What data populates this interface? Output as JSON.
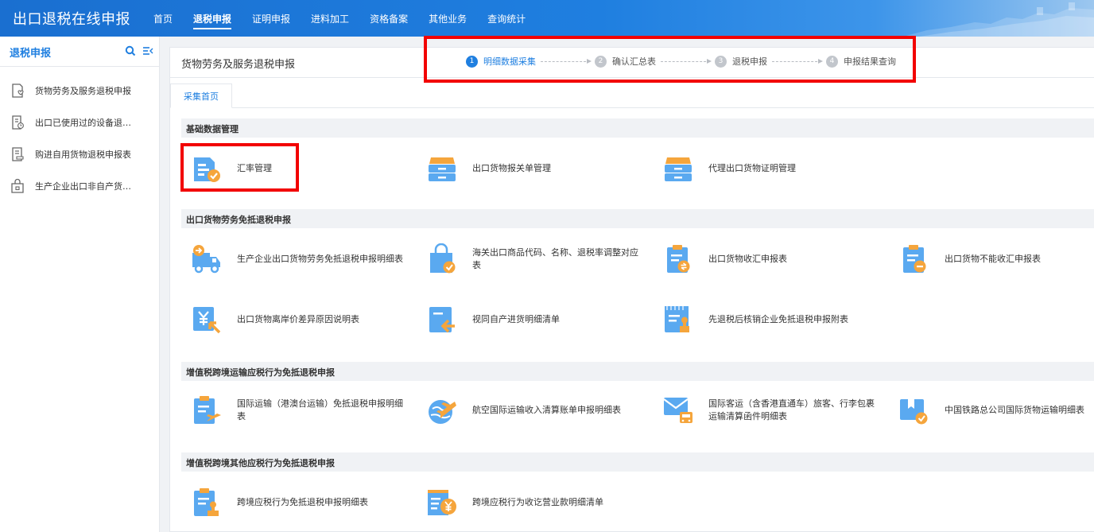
{
  "app": {
    "title": "出口退税在线申报"
  },
  "nav": {
    "items": [
      {
        "label": "首页"
      },
      {
        "label": "退税申报",
        "active": true
      },
      {
        "label": "证明申报"
      },
      {
        "label": "进料加工"
      },
      {
        "label": "资格备案"
      },
      {
        "label": "其他业务"
      },
      {
        "label": "查询统计"
      }
    ]
  },
  "sidebar": {
    "title": "退税申报",
    "items": [
      {
        "label": "货物劳务及服务退税申报"
      },
      {
        "label": "出口已使用过的设备退税申报"
      },
      {
        "label": "购进自用货物退税申报表"
      },
      {
        "label": "生产企业出口非自产货物消费税申报"
      }
    ]
  },
  "page": {
    "title": "货物劳务及服务退税申报",
    "steps": [
      {
        "num": "1",
        "label": "明细数据采集",
        "active": true
      },
      {
        "num": "2",
        "label": "确认汇总表"
      },
      {
        "num": "3",
        "label": "退税申报"
      },
      {
        "num": "4",
        "label": "申报结果查询"
      }
    ],
    "tab": "采集首页"
  },
  "sections": [
    {
      "title": "基础数据管理",
      "cards": [
        {
          "label": "汇率管理",
          "icon": "doc-check-icon"
        },
        {
          "label": "出口货物报关单管理",
          "icon": "cabinet-icon"
        },
        {
          "label": "代理出口货物证明管理",
          "icon": "cabinet-icon"
        }
      ]
    },
    {
      "title": "出口货物劳务免抵退税申报",
      "cards": [
        {
          "label": "生产企业出口货物劳务免抵退税申报明细表",
          "icon": "truck-icon"
        },
        {
          "label": "海关出口商品代码、名称、退税率调整对应表",
          "icon": "bag-icon"
        },
        {
          "label": "出口货物收汇申报表",
          "icon": "clipboard-exchange-icon"
        },
        {
          "label": "出口货物不能收汇申报表",
          "icon": "clipboard-minus-icon"
        },
        {
          "label": "出口货物离岸价差异原因说明表",
          "icon": "yen-arrow-icon"
        },
        {
          "label": "视同自产进货明细清单",
          "icon": "doc-arrow-icon"
        },
        {
          "label": "先退税后核销企业免抵退税申报附表",
          "icon": "calendar-stamp-icon"
        }
      ]
    },
    {
      "title": "增值税跨境运输应税行为免抵退税申报",
      "cards": [
        {
          "label": "国际运输（港澳台运输）免抵退税申报明细表",
          "icon": "clipboard-plane-icon"
        },
        {
          "label": "航空国际运输收入清算账单申报明细表",
          "icon": "globe-plane-icon"
        },
        {
          "label": "国际客运（含香港直通车）旅客、行李包裹运输清算函件明细表",
          "icon": "mail-bus-icon"
        },
        {
          "label": "中国铁路总公司国际货物运输明细表",
          "icon": "box-check-icon"
        }
      ]
    },
    {
      "title": "增值税跨境其他应税行为免抵退税申报",
      "cards": [
        {
          "label": "跨境应税行为免抵退税申报明细表",
          "icon": "clipboard-stamp-icon"
        },
        {
          "label": "跨境应税行为收讫营业款明细清单",
          "icon": "list-yen-icon"
        }
      ]
    }
  ],
  "colors": {
    "primary": "#1f7fe0",
    "icon_blue": "#5aa9f0",
    "icon_orange": "#f5a53c",
    "highlight": "#f20000"
  }
}
